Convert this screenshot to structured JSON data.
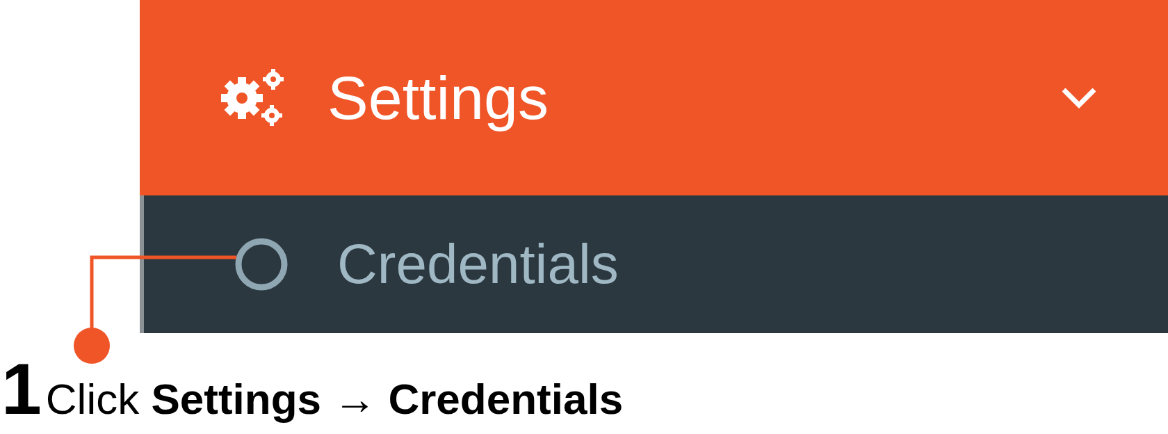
{
  "menu": {
    "header": {
      "label": "Settings",
      "expanded": true
    },
    "items": [
      {
        "label": "Credentials",
        "selected": false
      }
    ]
  },
  "callout": {
    "number": "1",
    "text": "Click **Settings → Credentials**"
  }
}
